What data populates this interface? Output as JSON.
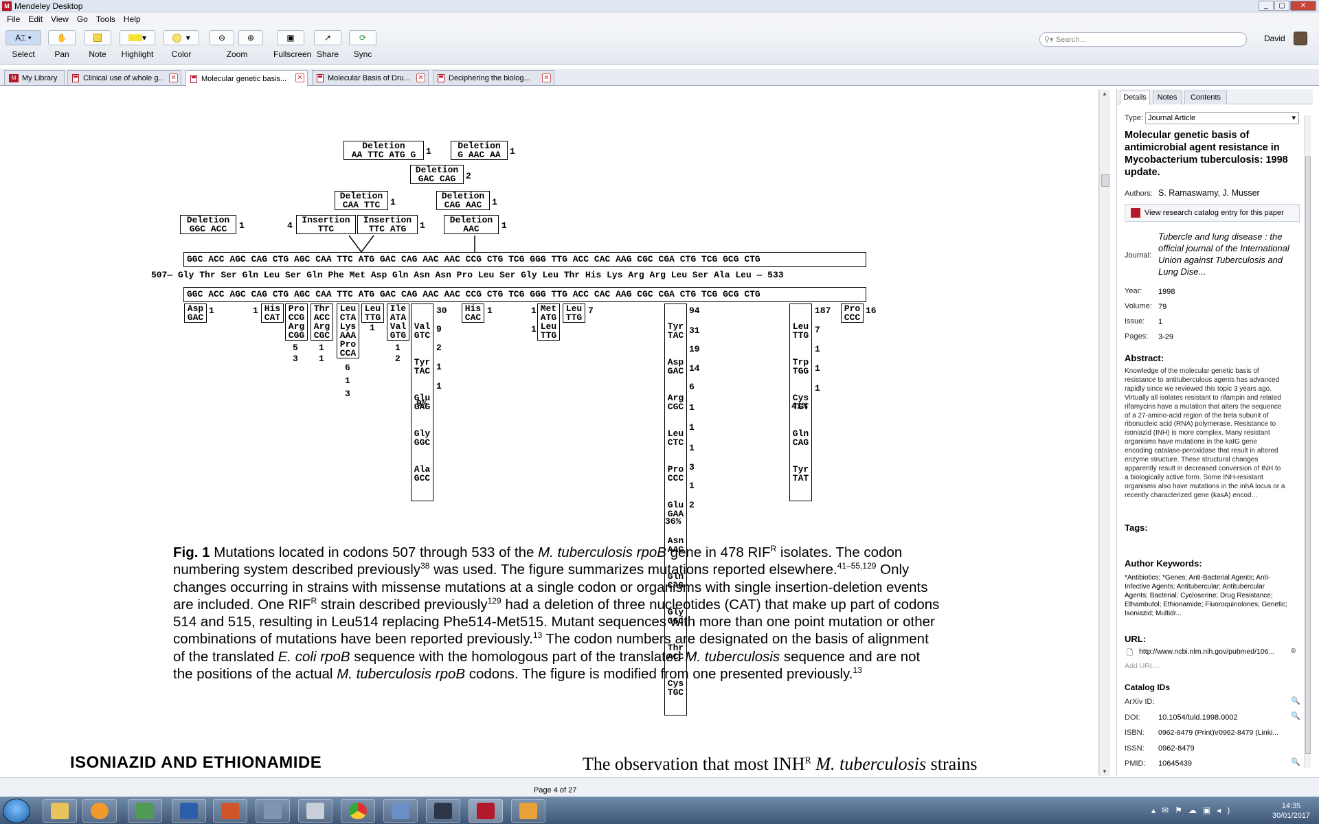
{
  "window": {
    "title": "Mendeley Desktop",
    "controls": [
      "_",
      "▢",
      "✕"
    ]
  },
  "menu": [
    "File",
    "Edit",
    "View",
    "Go",
    "Tools",
    "Help"
  ],
  "toolbar": {
    "tools": [
      "Select",
      "Pan",
      "Note",
      "Highlight",
      "Color",
      "Zoom",
      "Fullscreen",
      "Share",
      "Sync"
    ],
    "search_placeholder": "Search...",
    "user": "David"
  },
  "tabs": [
    {
      "label": "My Library"
    },
    {
      "label": "Clinical use of whole g..."
    },
    {
      "label": "Molecular genetic basis..."
    },
    {
      "label": "Molecular Basis of Dru..."
    },
    {
      "label": "Deciphering the biolog..."
    }
  ],
  "figure": {
    "top_boxes": [
      {
        "l1": "Deletion",
        "l2": "AA TTC ATG G",
        "n": "1"
      },
      {
        "l1": "Deletion",
        "l2": "G AAC AA",
        "n": "1"
      },
      {
        "l1": "Deletion",
        "l2": "GAC CAG",
        "n": "2"
      },
      {
        "l1": "Deletion",
        "l2": "CAA TTC",
        "n": "1"
      },
      {
        "l1": "Deletion",
        "l2": "CAG AAC",
        "n": "1"
      },
      {
        "l1": "Deletion",
        "l2": "GGC ACC",
        "n": "1"
      },
      {
        "l1": "Insertion",
        "l2": "TTC",
        "n": "4"
      },
      {
        "l1": "Insertion",
        "l2": "TTC ATG",
        "n": "1"
      },
      {
        "l1": "Deletion",
        "l2": "AAC",
        "n": "1"
      }
    ],
    "codons": "GGC ACC AGC CAG CTG AGC CAA TTC ATG GAC CAG AAC AAC CCG CTG TCG GGG TTG ACC CAC AAG CGC CGA CTG TCG GCG CTG",
    "aa_line": "507— Gly Thr Ser Gln Leu Ser Gln Phe Met Asp Gln Asn Asn Pro Leu Ser Gly Leu Thr His Lys Arg Arg Leu Ser Ala Leu — 533",
    "mutations": [
      {
        "l1": "Asp",
        "l2": "GAC",
        "n": "1"
      },
      {
        "l1": "His",
        "l2": "CAT",
        "n": "1"
      },
      {
        "l1": "Pro",
        "l2": "CCG",
        "n": ""
      },
      {
        "l1": "Arg",
        "l2": "CGG",
        "n": ""
      },
      {
        "l1": "Thr",
        "l2": "ACC",
        "n": ""
      },
      {
        "l1": "Arg",
        "l2": "CGC",
        "n": ""
      },
      {
        "l1": "Leu",
        "l2": "CTA",
        "n": ""
      },
      {
        "l1": "Lys",
        "l2": "AAA",
        "n": ""
      },
      {
        "l1": "Pro",
        "l2": "CCA",
        "n": ""
      },
      {
        "l1": "Leu",
        "l2": "TTG",
        "n": "1"
      },
      {
        "l1": "Ile",
        "l2": "ATA",
        "n": ""
      },
      {
        "l1": "Val",
        "l2": "GTG",
        "n": ""
      },
      {
        "l1": "Val",
        "l2": "GTC",
        "n": "30"
      },
      {
        "l1": "Tyr",
        "l2": "TAC",
        "n": "9"
      },
      {
        "l1": "Glu",
        "l2": "GAG",
        "n": "2"
      },
      {
        "l1": "Gly",
        "l2": "GGC",
        "n": "1"
      },
      {
        "l1": "Ala",
        "l2": "GCC",
        "n": "1"
      },
      {
        "l1": "His",
        "l2": "CAC",
        "n": "1"
      },
      {
        "l1": "Met",
        "l2": "ATG",
        "n": "1"
      },
      {
        "l1": "Leu",
        "l2": "TTG",
        "n": "1"
      },
      {
        "l1": "Leu",
        "l2": "TTG",
        "n": "7"
      },
      {
        "l1": "Tyr",
        "l2": "TAC",
        "n": "94"
      },
      {
        "l1": "Asp",
        "l2": "GAC",
        "n": "31"
      },
      {
        "l1": "Arg",
        "l2": "CGC",
        "n": "19"
      },
      {
        "l1": "Leu",
        "l2": "CTC",
        "n": "14"
      },
      {
        "l1": "Pro",
        "l2": "CCC",
        "n": "6"
      },
      {
        "l1": "Glu",
        "l2": "GAA",
        "n": "1"
      },
      {
        "l1": "Asn",
        "l2": "AAC",
        "n": "1"
      },
      {
        "l1": "Gln",
        "l2": "CAG",
        "n": "1"
      },
      {
        "l1": "Gly",
        "l2": "GGC",
        "n": "3"
      },
      {
        "l1": "Thr",
        "l2": "ACC",
        "n": "1"
      },
      {
        "l1": "Cys",
        "l2": "TGC",
        "n": "2"
      },
      {
        "l1": "Leu",
        "l2": "TTG",
        "n": "187"
      },
      {
        "l1": "Trp",
        "l2": "TGG",
        "n": "7"
      },
      {
        "l1": "Cys",
        "l2": "TGT",
        "n": "1"
      },
      {
        "l1": "Gln",
        "l2": "CAG",
        "n": "1"
      },
      {
        "l1": "Tyr",
        "l2": "TAT",
        "n": "1"
      },
      {
        "l1": "Pro",
        "l2": "CCC",
        "n": "16"
      }
    ],
    "loose_numbers": [
      "1",
      "5",
      "3",
      "1",
      "1",
      "6",
      "1",
      "3",
      "1",
      "2",
      "1"
    ],
    "percents": [
      "9%",
      "36%",
      "41%"
    ]
  },
  "caption": {
    "fig": "Fig. 1",
    "p1": " Mutations located in codons 507 through 533 of the ",
    "species1": "M. tuberculosis rpoB",
    "p2": " gene in 478 RIF",
    "sup1": "R",
    "p3": " isolates. The codon numbering system described previously",
    "sup2": "38",
    "p4": " was used. The figure summarizes mutations reported elsewhere.",
    "sup3": "41–55,129",
    "p5": " Only changes occurring in strains with missense mutations at a single codon or organisms with single insertion-deletion events are included. One RIF",
    "sup4": "R",
    "p6": " strain described previously",
    "sup5": "129",
    "p7": " had a deletion of three nucleotides (CAT) that make up part of codons 514 and 515, resulting in Leu514 replacing Phe514-Met515. Mutant sequences with more than one point mutation or other combinations of mutations have been reported previously.",
    "sup6": "13",
    "p8": " The codon numbers are designated on the basis of alignment of the translated ",
    "species2": "E. coli rpoB",
    "p9": " sequence with the homologous part of the translated ",
    "species3": "M. tuberculosis",
    "p10": " sequence and are not the positions of the actual ",
    "species4": "M. tuberculosis rpoB",
    "p11": " codons. The figure is modified from one presented previously.",
    "sup7": "13"
  },
  "section_heading": "ISONIAZID AND ETHIONAMIDE",
  "next_text": {
    "a": "The observation that most INH",
    "sup": "R",
    "b": "M. tuberculosis",
    "c": " strains"
  },
  "status": {
    "page": "Page 4 of 27"
  },
  "details": {
    "tabs": [
      "Details",
      "Notes",
      "Contents"
    ],
    "type_label": "Type:",
    "type_value": "Journal Article",
    "title": "Molecular genetic basis of antimicrobial agent resistance in Mycobacterium tuberculosis: 1998 update.",
    "authors_label": "Authors:",
    "authors": "S. Ramaswamy, J. Musser",
    "catalog_button": "View research catalog entry for this paper",
    "journal_label": "Journal:",
    "journal": "Tubercle and lung disease : the official journal of the International Union against Tuberculosis and Lung Dise...",
    "year_label": "Year:",
    "year": "1998",
    "volume_label": "Volume:",
    "volume": "79",
    "issue_label": "Issue:",
    "issue": "1",
    "pages_label": "Pages:",
    "pages": "3-29",
    "abstract_label": "Abstract:",
    "abstract": "Knowledge of the molecular genetic basis of resistance to antituberculous agents has advanced rapidly since we reviewed this topic 3 years ago. Virtually all isolates resistant to rifampin and related rifamycins have a mutation that alters the sequence of a 27-amino-acid region of the beta subunit of ribonucleic acid (RNA) polymerase. Resistance to isoniazid (INH) is more complex. Many resistant organisms have mutations in the katG gene encoding catalase-peroxidase that result in altered enzyme structure. These structural changes apparently result in decreased conversion of INH to a biologically active form. Some INH-resistant organisms also have mutations in the inhA locus or a recently characterized gene (kasA) encod...",
    "tags_label": "Tags:",
    "keywords_label": "Author Keywords:",
    "keywords": "*Antibiotics; *Genes; Anti-Bacterial Agents; Anti-Infective Agents; Antitubercular; Antitubercular Agents; Bacterial; Cycloserine; Drug Resistance; Ethambutol; Ethionamide; Fluoroquinolones; Genetic; Isoniazid; Multidr...",
    "url_label": "URL:",
    "url": "http://www.ncbi.nlm.nih.gov/pubmed/106...",
    "add_url": "Add URL...",
    "catalog_label": "Catalog IDs",
    "arxiv_label": "ArXiv ID:",
    "doi_label": "DOI:",
    "doi": "10.1054/tuld.1998.0002",
    "isbn_label": "ISBN:",
    "isbn": "0962-8479 (Print)\\r0962-8479 (Linki...",
    "issn_label": "ISSN:",
    "issn": "0962-8479",
    "pmid_label": "PMID:",
    "pmid": "10645439"
  },
  "taskbar": {
    "time": "14:35",
    "date": "30/01/2017"
  }
}
